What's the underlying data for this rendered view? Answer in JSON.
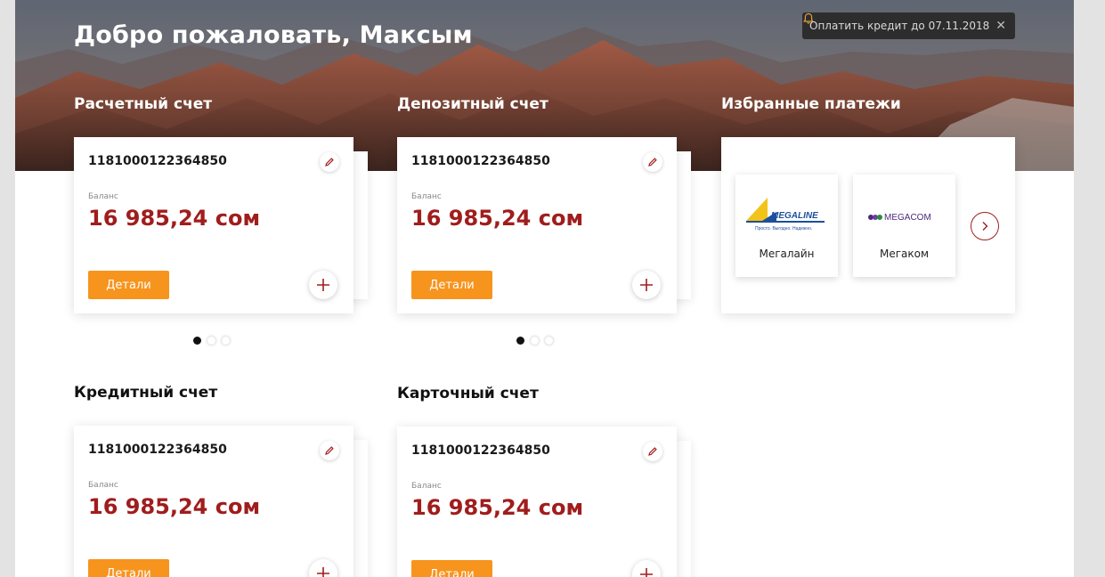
{
  "header": {
    "welcome": "Добро пожаловать, Максым",
    "notification": "Оплатить кредит до 07.11.2018"
  },
  "sections": {
    "current": "Расчетный счет",
    "deposit": "Депозитный счет",
    "favorites": "Избранные платежи",
    "credit": "Кредитный счет",
    "card": "Карточный счет"
  },
  "accounts": [
    {
      "number": "1181000122364850",
      "balance_label": "Баланс",
      "balance": "16 985,24 сом",
      "details_label": "Детали"
    },
    {
      "number": "1181000122364850",
      "balance_label": "Баланс",
      "balance": "16 985,24 сом",
      "details_label": "Детали"
    },
    {
      "number": "1181000122364850",
      "balance_label": "Баланс",
      "balance": "16 985,24 сом",
      "details_label": "Детали"
    },
    {
      "number": "1181000122364850",
      "balance_label": "Баланс",
      "balance": "16 985,24 сом",
      "details_label": "Детали"
    }
  ],
  "favorites": [
    {
      "name": "Мегалайн",
      "logo_text": "MEGALINE",
      "logo_tagline": "Просто. Выгодно. Надежно."
    },
    {
      "name": "Мегаком",
      "logo_text": "MEGACOM"
    }
  ],
  "pagination": {
    "current_pages": 3,
    "current_active": 1,
    "deposit_pages": 3,
    "deposit_active": 1
  },
  "colors": {
    "accent": "#a01d1d",
    "button": "#f7941d",
    "notification_bg": "#282828"
  },
  "icons": [
    "bell-icon",
    "close-icon",
    "pencil-icon",
    "plus-icon",
    "chevron-right-icon"
  ]
}
